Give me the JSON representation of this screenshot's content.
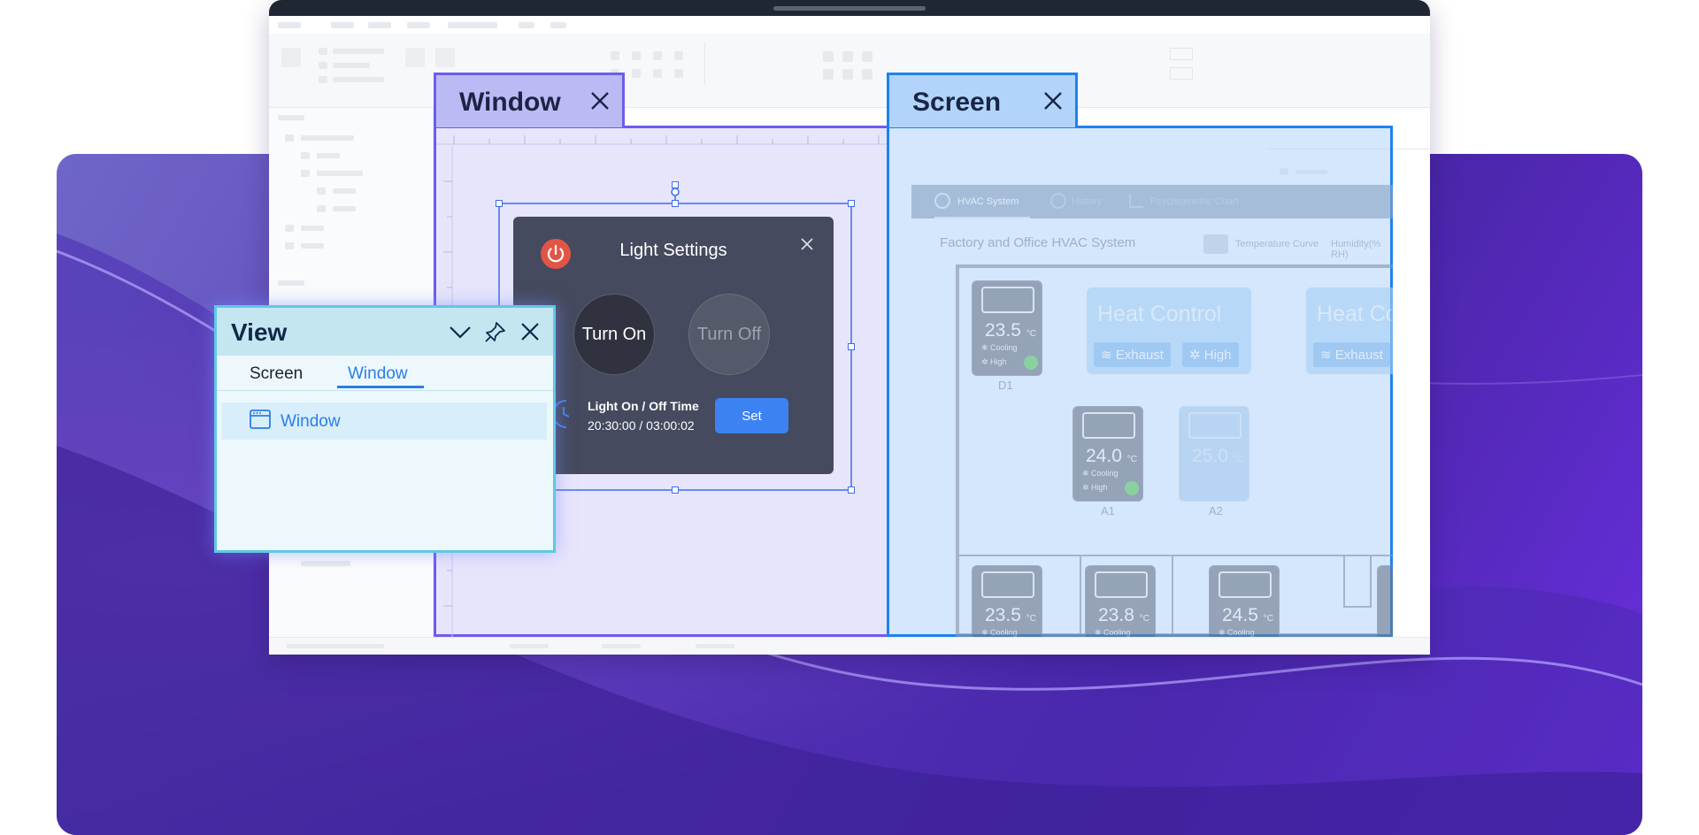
{
  "tabs": {
    "window": "Window",
    "screen": "Screen"
  },
  "dialog": {
    "title": "Light Settings",
    "turn_on": "Turn On",
    "turn_off": "Turn Off",
    "time_label": "Light On / Off Time",
    "time_value": "20:30:00 / 03:00:02",
    "set_label": "Set"
  },
  "view_panel": {
    "title": "View",
    "tabs": [
      "Screen",
      "Window"
    ],
    "active_tab": "Window",
    "items": [
      "Window"
    ]
  },
  "hvac": {
    "tabs": [
      "HVAC System",
      "History",
      "Psychrometric Chart"
    ],
    "title": "Factory and Office HVAC System",
    "legend": [
      "Temperature Curve",
      "Humidity(% RH)"
    ],
    "heat_controls": [
      {
        "title": "Heat Control",
        "buttons": [
          "Exhaust",
          "High"
        ]
      },
      {
        "title": "Heat Co",
        "buttons": [
          "Exhaust"
        ]
      }
    ],
    "units": [
      {
        "name": "D1",
        "temp": "23.5",
        "unit": "°C",
        "mode": "Cooling",
        "fan": "High"
      },
      {
        "name": "A1",
        "temp": "24.0",
        "unit": "°C",
        "mode": "Cooling",
        "fan": "High"
      },
      {
        "name": "A2",
        "temp": "25.0",
        "unit": "°C",
        "mode": "",
        "fan": ""
      },
      {
        "name": "",
        "temp": "23.5",
        "unit": "°C",
        "mode": "Cooling",
        "fan": ""
      },
      {
        "name": "",
        "temp": "23.8",
        "unit": "°C",
        "mode": "Cooling",
        "fan": ""
      },
      {
        "name": "",
        "temp": "24.5",
        "unit": "°C",
        "mode": "Cooling",
        "fan": ""
      }
    ]
  },
  "colors": {
    "window_accent": "#6d5cef",
    "screen_accent": "#1e82ee",
    "view_accent": "#60c8e4",
    "power_red": "#e25545",
    "set_blue": "#3d82f2"
  },
  "icons": [
    "close-icon",
    "power-icon",
    "clock-icon",
    "chevron-down-icon",
    "pin-icon",
    "window-icon"
  ]
}
